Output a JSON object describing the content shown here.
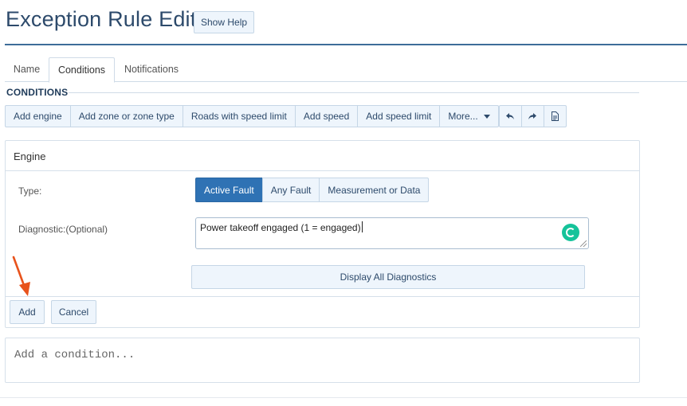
{
  "header": {
    "title": "Exception Rule Edit",
    "help_button": "Show Help"
  },
  "tabs": [
    {
      "label": "Name",
      "active": false
    },
    {
      "label": "Conditions",
      "active": true
    },
    {
      "label": "Notifications",
      "active": false
    }
  ],
  "section_label": "CONDITIONS",
  "toolbar": {
    "buttons": [
      "Add engine",
      "Add zone or zone type",
      "Roads with speed limit",
      "Add speed",
      "Add speed limit",
      "More..."
    ],
    "icons": [
      "undo-icon",
      "redo-icon",
      "document-icon"
    ]
  },
  "engine_panel": {
    "title": "Engine",
    "type_label": "Type:",
    "type_options": [
      {
        "label": "Active Fault",
        "selected": true
      },
      {
        "label": "Any Fault",
        "selected": false
      },
      {
        "label": "Measurement or Data",
        "selected": false
      }
    ],
    "diagnostic_label": "Diagnostic:(Optional)",
    "diagnostic_value": "Power takeoff engaged (1 = engaged)",
    "display_all_button": "Display All Diagnostics",
    "add_button": "Add",
    "cancel_button": "Cancel"
  },
  "add_condition_placeholder": "Add a condition...",
  "colors": {
    "accent": "#2f72b4",
    "title": "#2d4a6b",
    "button_bg": "#eef5fc",
    "annotation_arrow": "#e8531c",
    "grammarly": "#15c39a"
  }
}
